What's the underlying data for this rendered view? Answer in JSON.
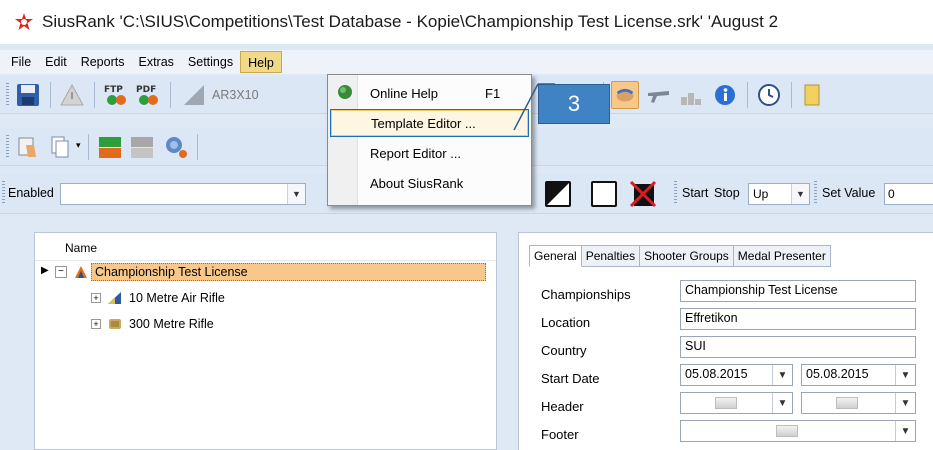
{
  "window": {
    "title": "SiusRank   'C:\\SIUS\\Competitions\\Test Database - Kopie\\Championship Test License.srk'   'August 2"
  },
  "menubar": {
    "items": [
      "File",
      "Edit",
      "Reports",
      "Extras",
      "Settings",
      "Help"
    ],
    "active": "Help"
  },
  "toolbar": {
    "ar_label": "AR3X10",
    "enabled_label": "Enabled",
    "start_label": "Start",
    "stop_label": "Stop",
    "direction_value": "Up",
    "set_value_label": "Set Value",
    "set_value_partial": "0"
  },
  "help_menu": {
    "items": [
      {
        "label": "Online Help",
        "shortcut": "F1"
      },
      {
        "label": "Template Editor ...",
        "shortcut": ""
      },
      {
        "label": "Report Editor ...",
        "shortcut": ""
      },
      {
        "label": "About SiusRank",
        "shortcut": ""
      }
    ]
  },
  "callout": {
    "number": "3"
  },
  "tree": {
    "column_header": "Name",
    "root": "Championship Test License",
    "children": [
      "10 Metre Air Rifle",
      "300 Metre Rifle"
    ]
  },
  "details": {
    "tabs": [
      "General",
      "Penalties",
      "Shooter Groups",
      "Medal Presenter"
    ],
    "labels": {
      "championships": "Championships",
      "location": "Location",
      "country": "Country",
      "start_date": "Start Date",
      "header": "Header",
      "footer": "Footer"
    },
    "values": {
      "championships": "Championship Test License",
      "location": "Effretikon",
      "country": "SUI",
      "start_date": "05.08.2015",
      "end_date": "05.08.2015"
    }
  },
  "colors": {
    "accent_blue": "#3f83c4",
    "selection": "#f7c88a",
    "toolbar_bg": "#dbe7f5"
  }
}
